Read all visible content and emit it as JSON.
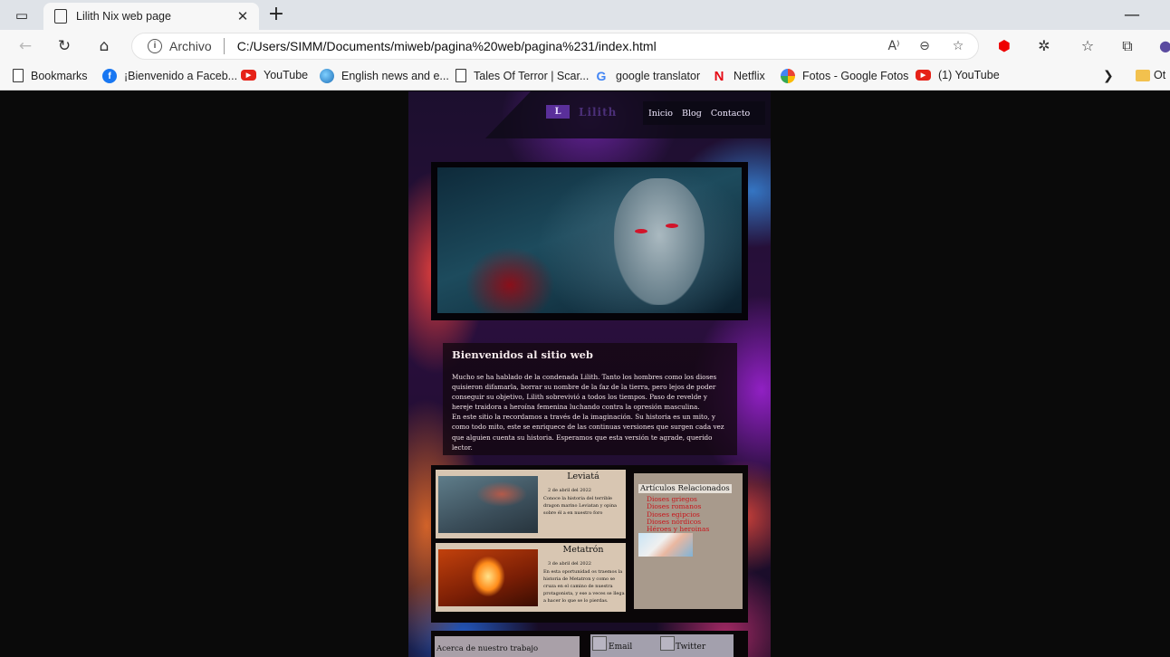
{
  "browser": {
    "tab_title": "Lilith Nix web page",
    "address_prefix": "Archivo",
    "url": "C:/Users/SIMM/Documents/miweb/pagina%20web/pagina%231/index.html",
    "bookmarks": [
      {
        "label": "Bookmarks",
        "icon": "page-icon"
      },
      {
        "label": "¡Bienvenido a Faceb...",
        "icon": "facebook-icon"
      },
      {
        "label": "YouTube",
        "icon": "youtube-icon"
      },
      {
        "label": "English news and e...",
        "icon": "globe-icon"
      },
      {
        "label": "Tales Of Terror | Scar...",
        "icon": "page-icon"
      },
      {
        "label": "google translator",
        "icon": "google-icon"
      },
      {
        "label": "Netflix",
        "icon": "netflix-icon"
      },
      {
        "label": "Fotos - Google Fotos",
        "icon": "google-photos-icon"
      },
      {
        "label": "(1) YouTube",
        "icon": "youtube-icon"
      }
    ],
    "other_bookmarks": "Ot"
  },
  "site": {
    "logo_mark": "L",
    "logo_word": "Lilith",
    "nav": [
      "Inicio",
      "Blog",
      "Contacto"
    ],
    "welcome_title": "Bienvenidos al sitio web",
    "welcome_p1": "Mucho se ha hablado de la condenada Lilith. Tanto los hombres como los dioses quisieron difamarla, borrar su nombre de la faz de la tierra, pero lejos de poder conseguir su objetivo, Lilith sobrevivió a todos los tiempos. Paso de revelde y hereje traidora a heroína femenina luchando contra la opresión masculina.",
    "welcome_p2": "En este sitio la recordamos a través de la imaginación. Su historia es un mito, y como todo mito, este se enriquece de las continuas versiones que surgen cada vez que alguien cuenta su historia. Esperamos que esta versión te agrade, querido lector.",
    "articles": [
      {
        "title": "Leviatá",
        "date": "2 de abril del 2022",
        "text": "Conoce la historia del terrible dragon marino Leviatan y opina sobre él a en nuestro foro"
      },
      {
        "title": "Metatrón",
        "date": "3 de abril del 2022",
        "text": "En esta oportunidad os traemos la historia de Metatron y como se cruza en el camino de nuestra protagonista, y ese a veces se llega a hacer lo que se lo pierdas."
      }
    ],
    "related_title": "Artículos Relacionados",
    "related_links": [
      "Dioses griegos",
      "Dioses romanos",
      "Dioses egipcios",
      "Dioses nórdicos",
      "Héroes y heroinas"
    ],
    "about_title": "Acerca de nuestro trabajo",
    "social": [
      "Email",
      "Twitter"
    ]
  }
}
